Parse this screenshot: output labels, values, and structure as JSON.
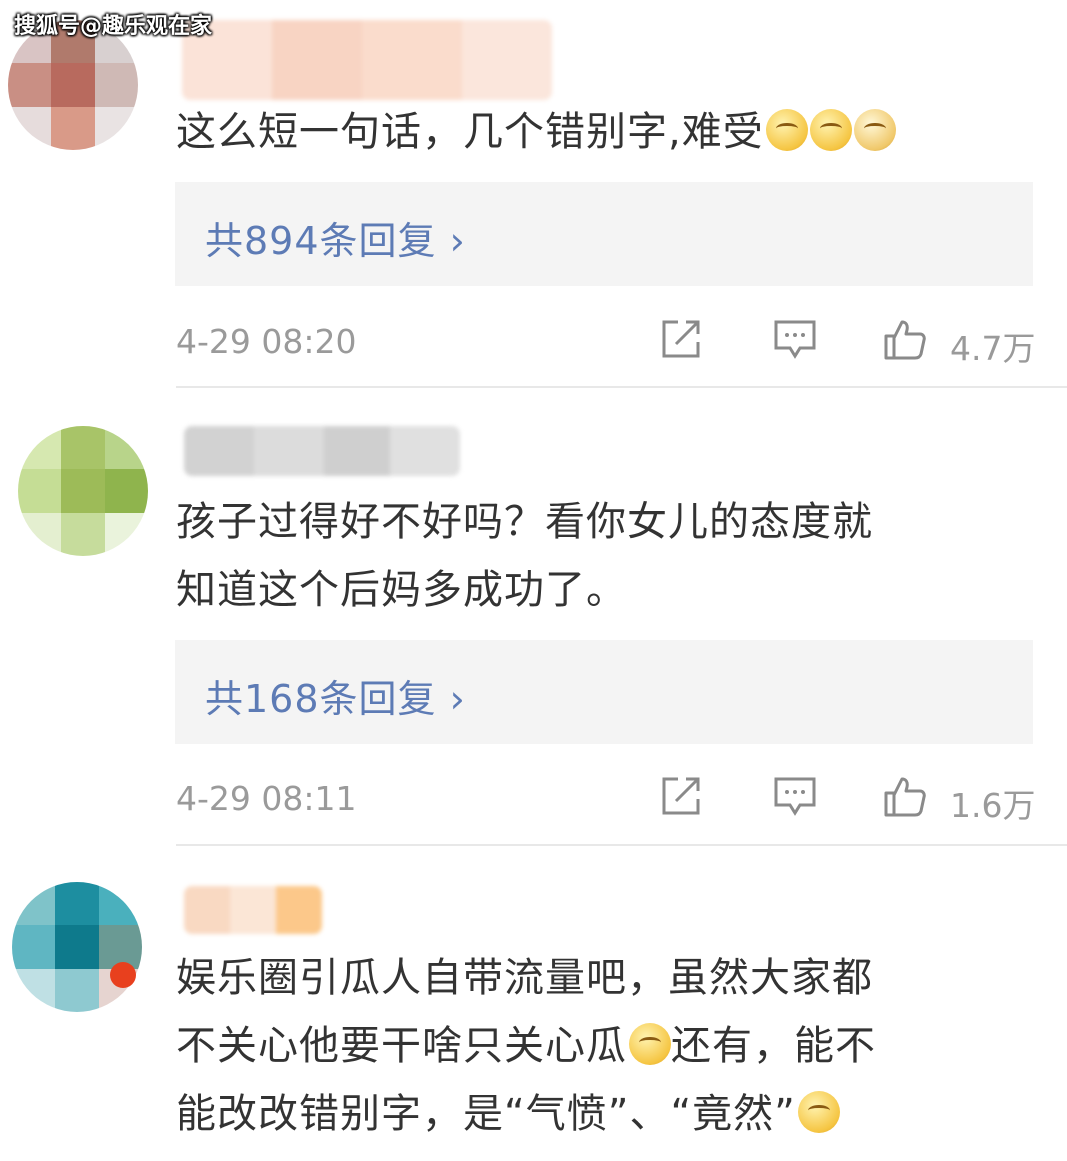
{
  "watermark": "搜狐号@趣乐观在家",
  "comments": [
    {
      "text": "这么短一句话，几个错别字,难受",
      "emojis": [
        "face-icon",
        "face-icon",
        "doge-icon"
      ],
      "replies_label": "共894条回复 ›",
      "time": "4-29 08:20",
      "likes": "4.7万"
    },
    {
      "text_lines": [
        "孩子过得好不好吗？看你女儿的态度就",
        "知道这个后妈多成功了。"
      ],
      "replies_label": "共168条回复 ›",
      "time": "4-29 08:11",
      "likes": "1.6万"
    },
    {
      "line1": "娱乐圈引瓜人自带流量吧，虽然大家都",
      "line2a": "不关心他要干啥只关心瓜",
      "line2b": "还有，能不",
      "line3": "能改改错别字，是“气愤”、“竟然”",
      "emojis": [
        "laugh-cry-icon",
        "sweat-icon"
      ]
    }
  ],
  "colors": {
    "reply_link": "#5d7bb5",
    "meta_gray": "#9a9a9a",
    "reply_bg": "#f4f4f4"
  }
}
